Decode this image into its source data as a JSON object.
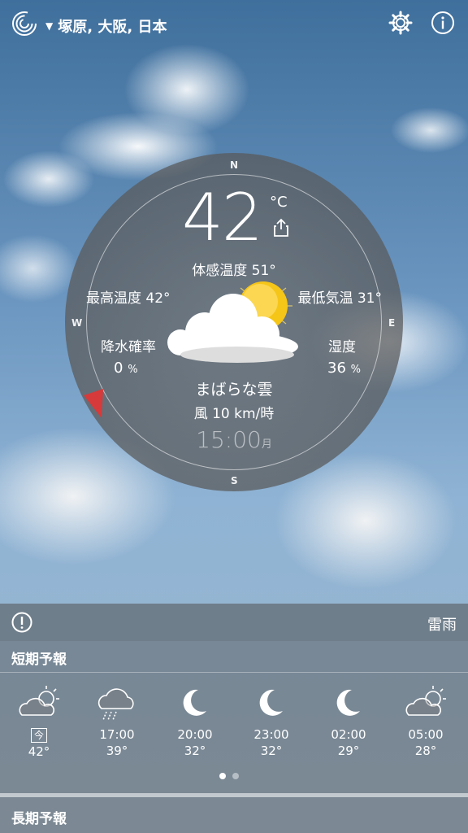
{
  "location": "塚原, 大阪, 日本",
  "current": {
    "temperature": "42",
    "unit": "°C",
    "feels_like": "体感温度 51°",
    "high": "最高温度 42°",
    "low": "最低気温 31°",
    "precip_label": "降水確率",
    "precip_value": "0",
    "precip_unit": "%",
    "humidity_label": "湿度",
    "humidity_value": "36",
    "humidity_unit": "%",
    "condition": "まばらな雲",
    "wind": "風 10 km/時",
    "time": "15:00",
    "day": "月",
    "icon": "partly-cloudy-day-icon"
  },
  "compass": {
    "n": "N",
    "s": "S",
    "e": "E",
    "w": "W"
  },
  "alert": {
    "text": "雷雨",
    "icon": "alert-icon"
  },
  "short_forecast": {
    "title": "短期予報",
    "items": [
      {
        "time": "今",
        "temp": "42°",
        "icon": "partly-cloudy-day-icon"
      },
      {
        "time": "17:00",
        "temp": "39°",
        "icon": "rain-cloud-icon"
      },
      {
        "time": "20:00",
        "temp": "32°",
        "icon": "moon-icon"
      },
      {
        "time": "23:00",
        "temp": "32°",
        "icon": "moon-icon"
      },
      {
        "time": "02:00",
        "temp": "29°",
        "icon": "moon-icon"
      },
      {
        "time": "05:00",
        "temp": "28°",
        "icon": "partly-cloudy-day-icon"
      }
    ]
  },
  "long_forecast": {
    "title": "長期予報"
  },
  "colors": {
    "accent": "#d63a3a",
    "sun": "#f5c518"
  }
}
